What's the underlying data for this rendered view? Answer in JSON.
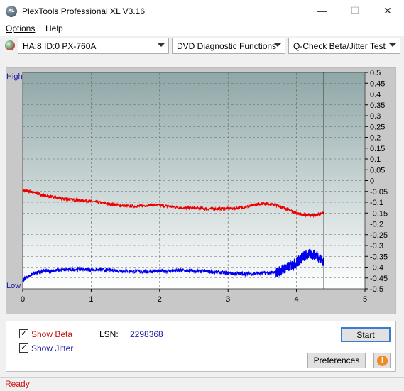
{
  "window": {
    "title": "PlexTools Professional XL V3.16",
    "icon_text": "XL",
    "minimize_glyph": "—",
    "maximize_glyph": "☐",
    "close_glyph": "✕"
  },
  "menu": [
    {
      "label": "Options",
      "accel": "O"
    },
    {
      "label": "Help",
      "accel": "H"
    }
  ],
  "toolbar": {
    "drive": "HA:8 ID:0  PX-760A",
    "function": "DVD Diagnostic Functions",
    "test": "Q-Check Beta/Jitter Test"
  },
  "chart_data": {
    "type": "line",
    "x_ticks": [
      "0",
      "1",
      "2",
      "3",
      "4",
      "5"
    ],
    "xlim": [
      0,
      5
    ],
    "left_labels": {
      "top": "High",
      "bottom": "Low"
    },
    "right_ticks": [
      "0.5",
      "0.45",
      "0.4",
      "0.35",
      "0.3",
      "0.25",
      "0.2",
      "0.15",
      "0.1",
      "0.05",
      "0",
      "-0.05",
      "-0.1",
      "-0.15",
      "-0.2",
      "-0.25",
      "-0.3",
      "-0.35",
      "-0.4",
      "-0.45",
      "-0.5"
    ],
    "ylim": [
      -0.5,
      0.5
    ],
    "cursor_x": 4.4,
    "grid": true,
    "series": [
      {
        "name": "Beta",
        "color": "#ee0000",
        "x": [
          0,
          0.1,
          0.2,
          0.3,
          0.5,
          0.7,
          0.9,
          1.1,
          1.3,
          1.5,
          1.7,
          1.9,
          2.1,
          2.3,
          2.5,
          2.7,
          2.9,
          3.1,
          3.3,
          3.45,
          3.55,
          3.7,
          3.85,
          4.0,
          4.1,
          4.2,
          4.3,
          4.4
        ],
        "values": [
          -0.045,
          -0.05,
          -0.058,
          -0.068,
          -0.08,
          -0.088,
          -0.092,
          -0.1,
          -0.11,
          -0.118,
          -0.118,
          -0.112,
          -0.118,
          -0.125,
          -0.128,
          -0.13,
          -0.13,
          -0.128,
          -0.12,
          -0.108,
          -0.105,
          -0.112,
          -0.13,
          -0.15,
          -0.158,
          -0.16,
          -0.158,
          -0.15
        ]
      },
      {
        "name": "Jitter",
        "color": "#0000ee",
        "x": [
          0,
          0.05,
          0.15,
          0.3,
          0.5,
          0.7,
          0.9,
          1.1,
          1.3,
          1.5,
          1.7,
          1.9,
          2.1,
          2.3,
          2.5,
          2.7,
          2.9,
          3.1,
          3.3,
          3.5,
          3.7,
          3.8,
          3.9,
          4.0,
          4.05,
          4.1,
          4.2,
          4.3,
          4.4
        ],
        "values": [
          -0.46,
          -0.45,
          -0.43,
          -0.42,
          -0.415,
          -0.41,
          -0.41,
          -0.412,
          -0.415,
          -0.418,
          -0.42,
          -0.42,
          -0.418,
          -0.415,
          -0.418,
          -0.42,
          -0.425,
          -0.43,
          -0.43,
          -0.428,
          -0.425,
          -0.41,
          -0.395,
          -0.38,
          -0.365,
          -0.35,
          -0.34,
          -0.345,
          -0.38
        ]
      }
    ]
  },
  "bottom": {
    "show_beta_label": "Show Beta",
    "show_jitter_label": "Show Jitter",
    "lsn_label": "LSN:",
    "lsn_value": "2298368",
    "start_label": "Start",
    "preferences_label": "Preferences",
    "info_glyph": "i"
  },
  "status": {
    "text": "Ready"
  }
}
